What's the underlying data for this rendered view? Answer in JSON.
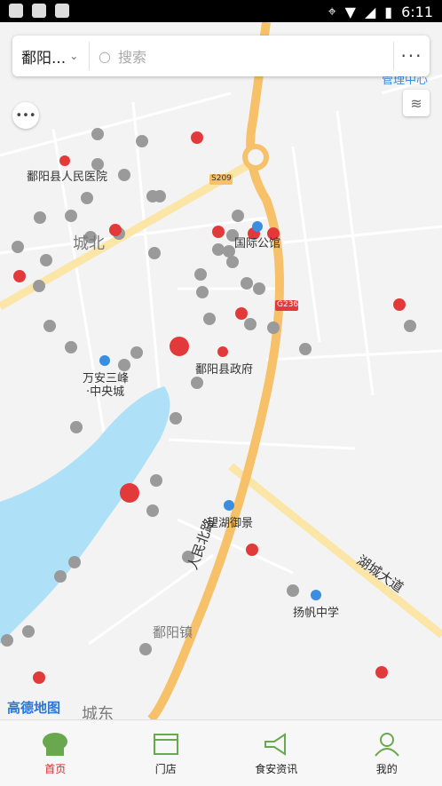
{
  "status_bar": {
    "time": "6:11"
  },
  "search_bar": {
    "city": "鄱阳...",
    "placeholder": "搜索",
    "more": "···"
  },
  "map_labels": {
    "hospital": "鄱阳县人民医院",
    "chengbei": "城北",
    "guoji": "国际公馆",
    "gov": "鄱阳县政府",
    "wanan1": "万安三峰",
    "wanan2": "·中央城",
    "wanghu": "望湖御景",
    "renmin": "人民北路",
    "hucheng": "湖城大道",
    "yangfan": "扬帆中学",
    "poyang": "鄱阳镇",
    "chengdong": "城东",
    "s209": "S209",
    "g236": "G236",
    "top_right": "管理中心"
  },
  "attribution": "高德地图",
  "tabs": [
    {
      "label": "首页",
      "icon": "chef-hat-icon",
      "active": true
    },
    {
      "label": "门店",
      "icon": "store-icon",
      "active": false
    },
    {
      "label": "食安资讯",
      "icon": "megaphone-icon",
      "active": false
    },
    {
      "label": "我的",
      "icon": "user-icon",
      "active": false
    }
  ],
  "colors": {
    "accent": "#e02020",
    "tab_green": "#6aa84f",
    "water": "#aee0f7",
    "highway": "#f7c169"
  }
}
